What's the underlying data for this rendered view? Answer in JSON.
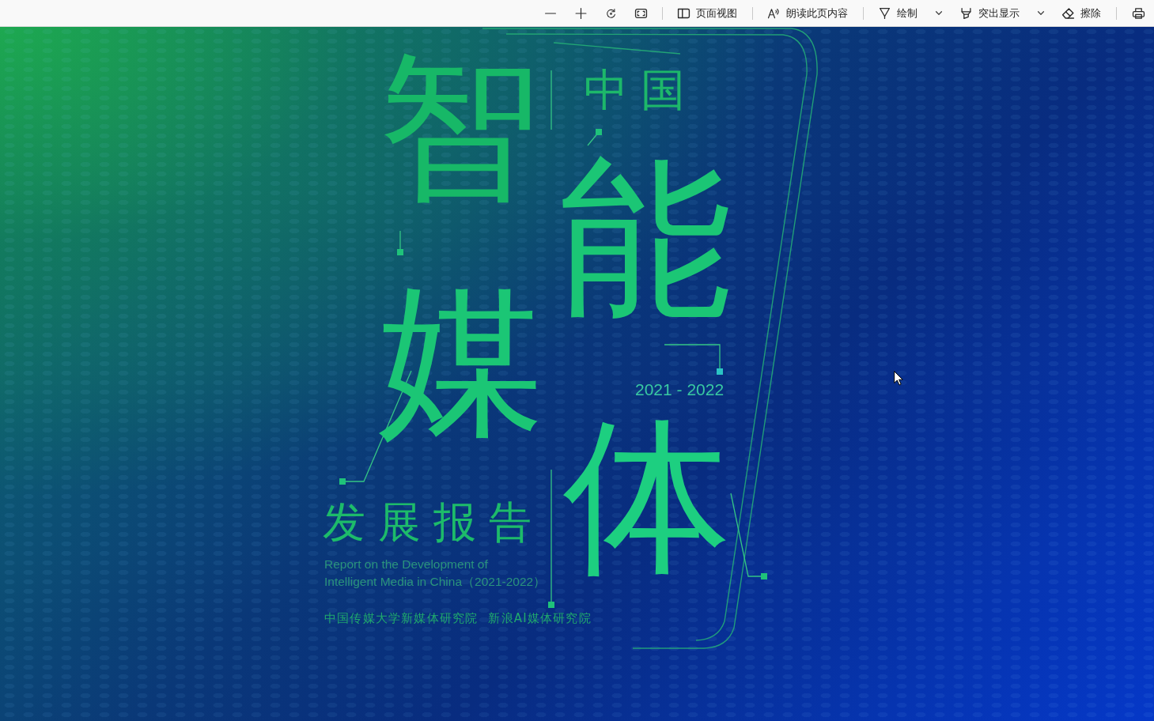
{
  "toolbar": {
    "page_view": "页面视图",
    "read_aloud": "朗读此页内容",
    "draw": "绘制",
    "highlight": "突出显示",
    "erase": "擦除"
  },
  "cover": {
    "country": "中国",
    "title_characters": [
      "智",
      "能",
      "媒",
      "体"
    ],
    "years": "2021 - 2022",
    "subtitle": "发展报告",
    "english_title": [
      "Report on the Development of",
      "Intelligent Media in China（2021-2022）"
    ],
    "publishers": [
      "中国传媒大学新媒体研究院",
      "新浪AI媒体研究院"
    ]
  }
}
